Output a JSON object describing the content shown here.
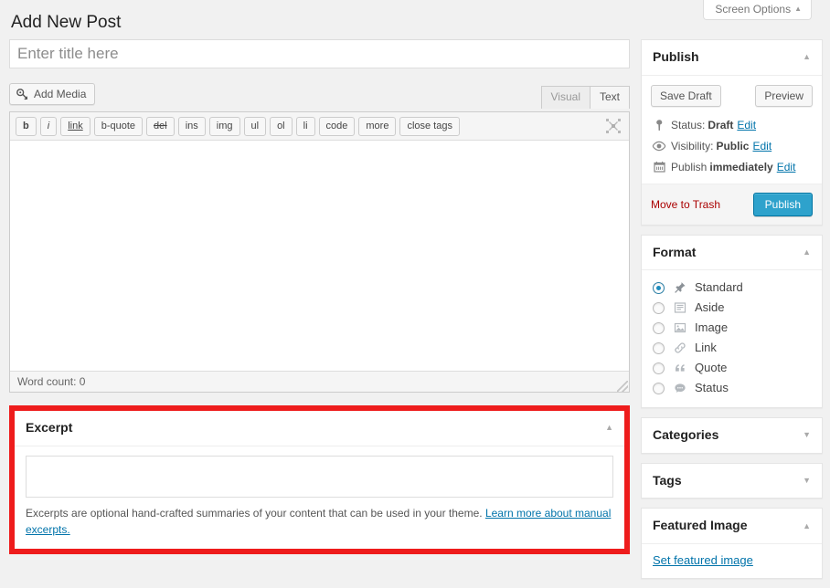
{
  "screen_meta": {
    "screen_options_label": "Screen Options",
    "toggle_icon": "chevron-up-icon"
  },
  "page": {
    "title": "Add New Post"
  },
  "title_field": {
    "value": "",
    "placeholder": "Enter title here"
  },
  "editor": {
    "add_media_label": "Add Media",
    "add_media_icon": "media-icon",
    "tabs": [
      {
        "label": "Visual",
        "active": false
      },
      {
        "label": "Text",
        "active": true
      }
    ],
    "quicktags": [
      {
        "label": "b",
        "style": "bold"
      },
      {
        "label": "i",
        "style": "italic"
      },
      {
        "label": "link",
        "style": "underline"
      },
      {
        "label": "b-quote",
        "style": ""
      },
      {
        "label": "del",
        "style": "strike"
      },
      {
        "label": "ins",
        "style": ""
      },
      {
        "label": "img",
        "style": ""
      },
      {
        "label": "ul",
        "style": ""
      },
      {
        "label": "ol",
        "style": ""
      },
      {
        "label": "li",
        "style": ""
      },
      {
        "label": "code",
        "style": ""
      },
      {
        "label": "more",
        "style": ""
      },
      {
        "label": "close tags",
        "style": ""
      }
    ],
    "fullscreen_icon": "distraction-free-icon",
    "content": "",
    "word_count_label": "Word count: 0"
  },
  "excerpt": {
    "panel_title": "Excerpt",
    "toggle_icon": "chevron-up-icon",
    "value": "",
    "hint_text": "Excerpts are optional hand-crafted summaries of your content that can be used in your theme. ",
    "hint_link": "Learn more about manual excerpts.",
    "highlight_color": "#ee1c1c"
  },
  "sidebar": {
    "publish": {
      "panel_title": "Publish",
      "toggle_icon": "chevron-up-icon",
      "save_draft_label": "Save Draft",
      "preview_label": "Preview",
      "status": {
        "icon": "pin-icon",
        "label": "Status:",
        "value": "Draft",
        "edit_label": "Edit"
      },
      "visibility": {
        "icon": "eye-icon",
        "label": "Visibility:",
        "value": "Public",
        "edit_label": "Edit"
      },
      "schedule": {
        "icon": "calendar-icon",
        "label": "Publish",
        "value": "immediately",
        "edit_label": "Edit"
      },
      "trash_label": "Move to Trash",
      "publish_label": "Publish",
      "publish_color": "#2ea2cc",
      "trash_color": "#aa0000"
    },
    "format": {
      "panel_title": "Format",
      "toggle_icon": "chevron-up-icon",
      "options": [
        {
          "label": "Standard",
          "icon": "pin-icon",
          "selected": true
        },
        {
          "label": "Aside",
          "icon": "aside-icon",
          "selected": false
        },
        {
          "label": "Image",
          "icon": "image-icon",
          "selected": false
        },
        {
          "label": "Link",
          "icon": "link-icon",
          "selected": false
        },
        {
          "label": "Quote",
          "icon": "quote-icon",
          "selected": false
        },
        {
          "label": "Status",
          "icon": "status-icon",
          "selected": false
        }
      ]
    },
    "categories": {
      "panel_title": "Categories",
      "toggle_icon": "chevron-down-icon",
      "collapsed": true
    },
    "tags": {
      "panel_title": "Tags",
      "toggle_icon": "chevron-down-icon",
      "collapsed": true
    },
    "featured_image": {
      "panel_title": "Featured Image",
      "toggle_icon": "chevron-up-icon",
      "set_link_label": "Set featured image"
    }
  }
}
